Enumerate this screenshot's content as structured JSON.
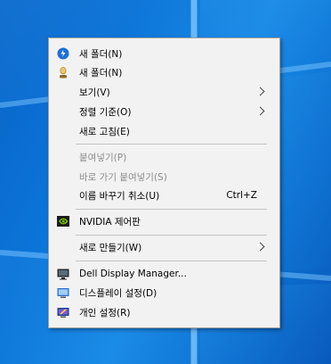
{
  "context_menu": {
    "items": [
      {
        "label": "새 폴더(N)"
      },
      {
        "label": "새 폴더(N)"
      },
      {
        "label": "보기(V)"
      },
      {
        "label": "정렬 기준(O)"
      },
      {
        "label": "새로 고침(E)"
      },
      {
        "label": "붙여넣기(P)"
      },
      {
        "label": "바로 가기 붙여넣기(S)"
      },
      {
        "label": "이름 바꾸기 취소(U)",
        "shortcut": "Ctrl+Z"
      },
      {
        "label": "NVIDIA 제어판"
      },
      {
        "label": "새로 만들기(W)"
      },
      {
        "label": "Dell Display Manager..."
      },
      {
        "label": "디스플레이 설정(D)"
      },
      {
        "label": "개인 설정(R)"
      }
    ]
  },
  "colors": {
    "menu_background": "#f2f2f2",
    "disabled_text": "#8c8c8c",
    "desktop_accent": "#0b74d8"
  }
}
